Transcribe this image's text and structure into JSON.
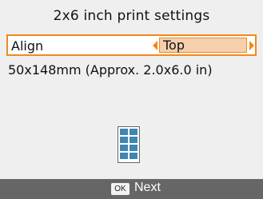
{
  "header": {
    "title": "2x6 inch print settings"
  },
  "setting": {
    "label": "Align",
    "value": "Top",
    "accent_color": "#f08a1c",
    "value_bg_color": "#f6cfae"
  },
  "info": {
    "size_text": "50x148mm (Approx. 2.0x6.0 in)"
  },
  "preview": {
    "icon_name": "print-layout-preview-icon",
    "color": "#3f86b5"
  },
  "footer": {
    "ok_label": "OK",
    "next_label": "Next"
  }
}
